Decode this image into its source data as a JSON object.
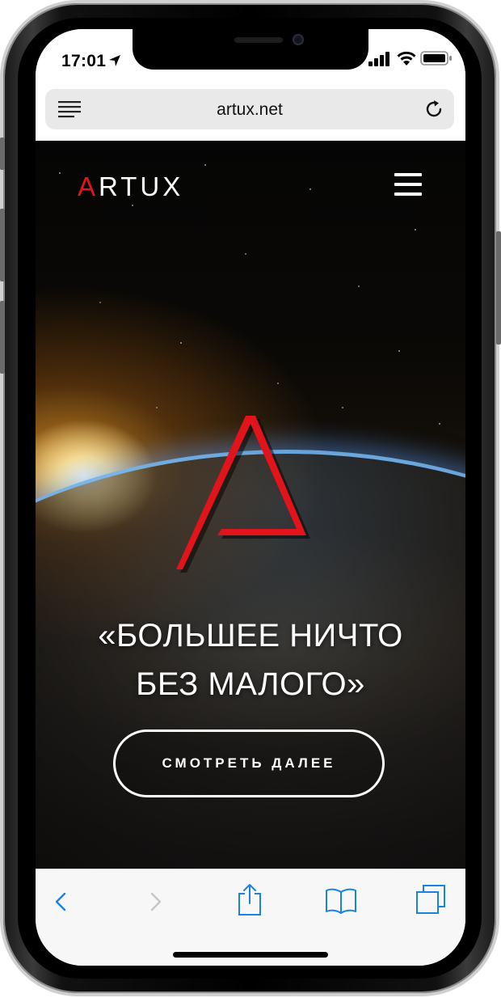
{
  "status_bar": {
    "time": "17:01"
  },
  "browser": {
    "url": "artux.net"
  },
  "site": {
    "logo_accent": "A",
    "logo_rest": "RTUX",
    "headline_line1": "«БОЛЬШЕЕ НИЧТО",
    "headline_line2": "БЕЗ МАЛОГО»",
    "cta_label": "СМОТРЕТЬ ДАЛЕЕ"
  },
  "colors": {
    "brand_red": "#e0141a",
    "accent_blue": "#1a82e2"
  },
  "icons": [
    "location-arrow-icon",
    "signal-icon",
    "wifi-icon",
    "battery-icon",
    "reader-menu-icon",
    "reload-icon",
    "hamburger-icon",
    "delta-logo-icon",
    "back-icon",
    "forward-icon",
    "share-icon",
    "bookmarks-icon",
    "tabs-icon"
  ]
}
